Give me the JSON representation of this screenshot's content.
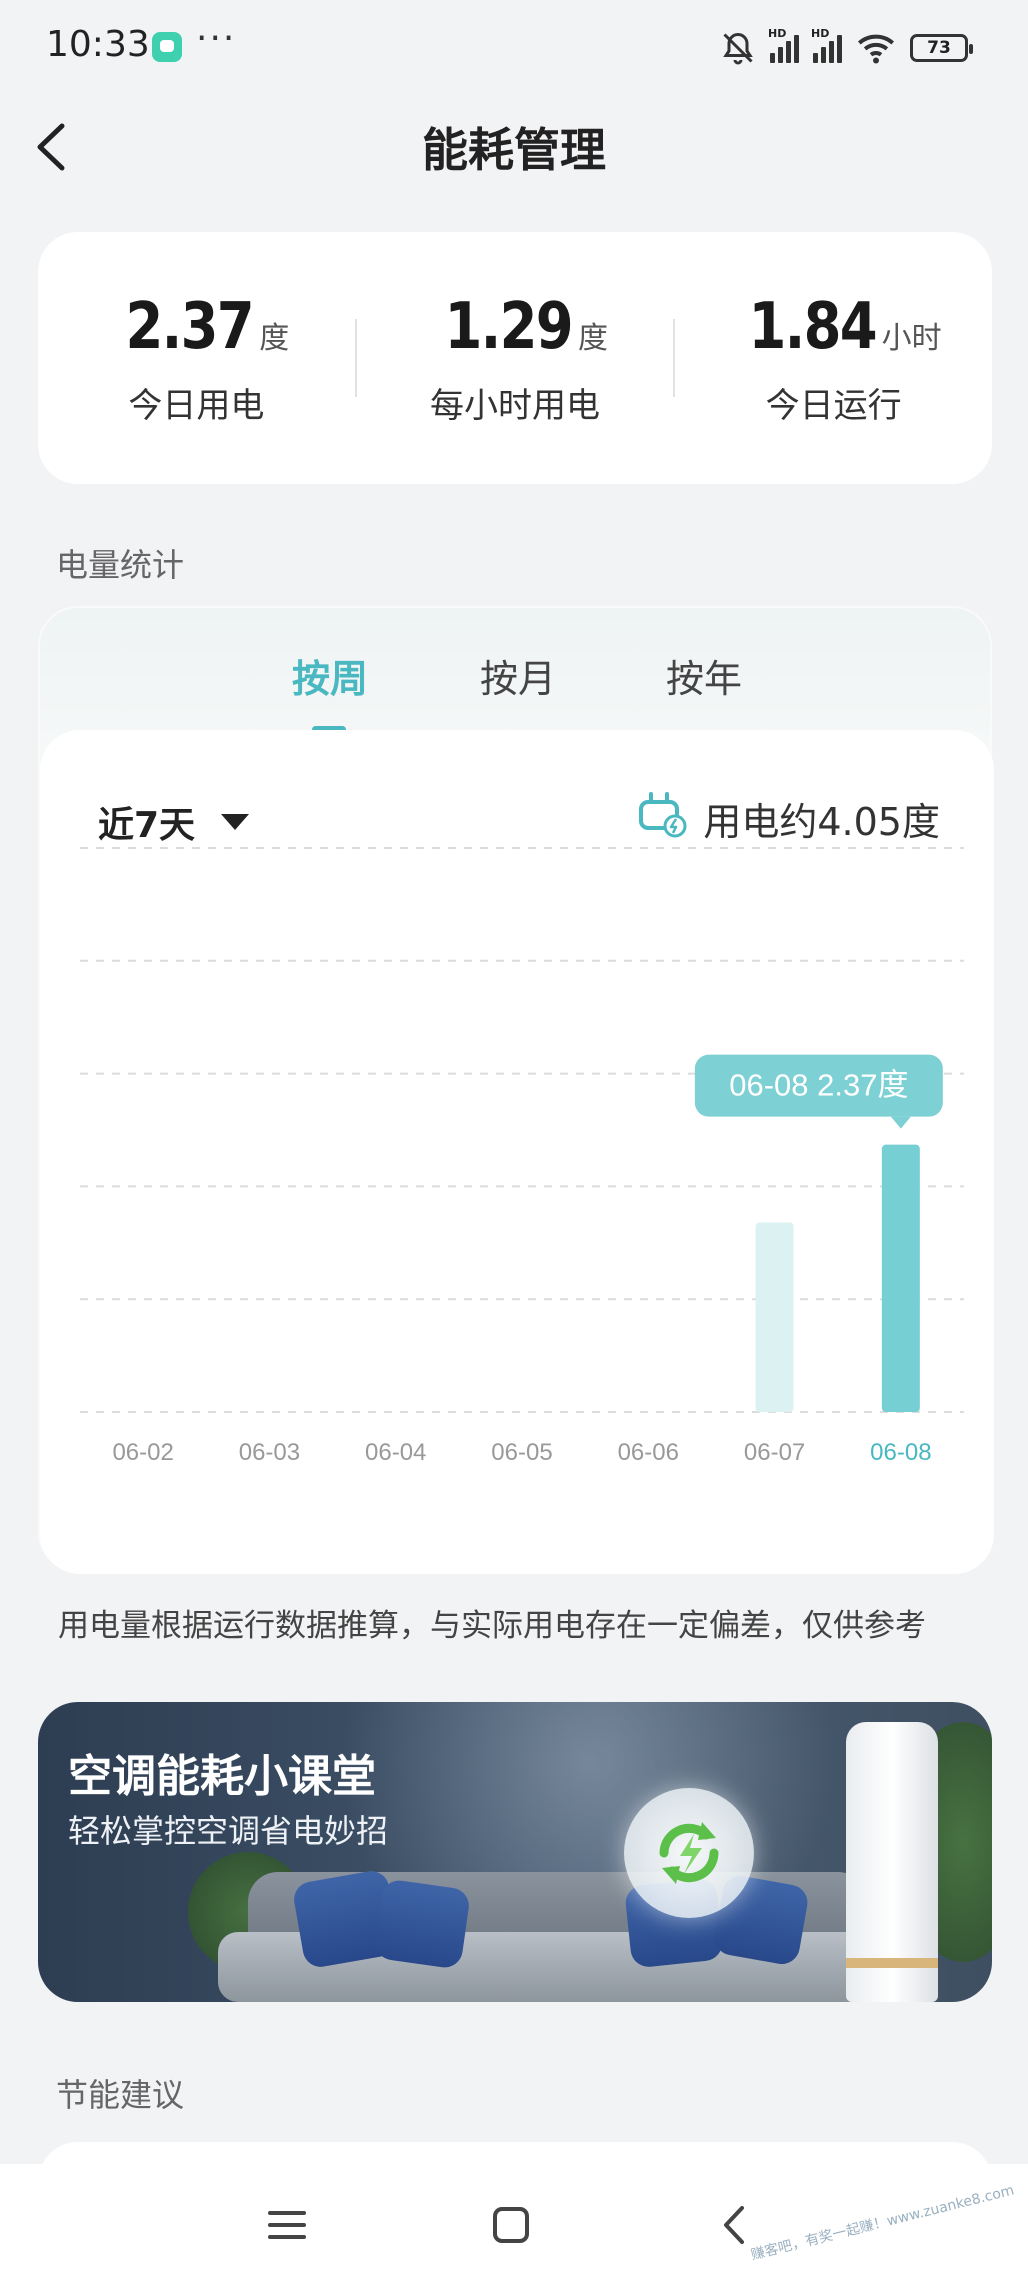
{
  "status_bar": {
    "time": "10:33",
    "more": "···",
    "battery": "73",
    "icons": [
      "notifications-off-icon",
      "signal-hd-icon",
      "signal-hd-icon",
      "wifi-icon",
      "battery-icon"
    ]
  },
  "header": {
    "title": "能耗管理",
    "back_icon": "chevron-left-icon"
  },
  "summary": [
    {
      "value": "2.37",
      "unit": "度",
      "label": "今日用电"
    },
    {
      "value": "1.29",
      "unit": "度",
      "label": "每小时用电"
    },
    {
      "value": "1.84",
      "unit": "小时",
      "label": "今日运行"
    }
  ],
  "stats_section": {
    "title": "电量统计",
    "tabs": [
      "按周",
      "按月",
      "按年"
    ],
    "active_tab": "按周",
    "range_label": "近7天",
    "total_label": "用电约4.05度"
  },
  "chart_data": {
    "type": "bar",
    "categories": [
      "06-02",
      "06-03",
      "06-04",
      "06-05",
      "06-06",
      "06-07",
      "06-08"
    ],
    "values": [
      0,
      0,
      0,
      0,
      0,
      1.68,
      2.37
    ],
    "selected": "06-08",
    "tooltip": "06-08 2.37度",
    "ylim": [
      0,
      5
    ],
    "grid": true,
    "colors": {
      "bar": "#dcf1f2",
      "bar_selected": "#76cfd3",
      "tooltip_bg": "#7dd0d4",
      "accent": "#49b8c0"
    }
  },
  "note": "用电量根据运行数据推算，与实际用电存在一定偏差，仅供参考",
  "banner": {
    "title": "空调能耗小课堂",
    "subtitle": "轻松掌控空调省电妙招"
  },
  "advice_section": {
    "title": "节能建议"
  },
  "nav_bar": {
    "icons": [
      "menu-icon",
      "home-square-icon",
      "back-arrow-icon"
    ]
  },
  "watermark": "赚客吧，有奖一起赚！www.zuanke8.com"
}
